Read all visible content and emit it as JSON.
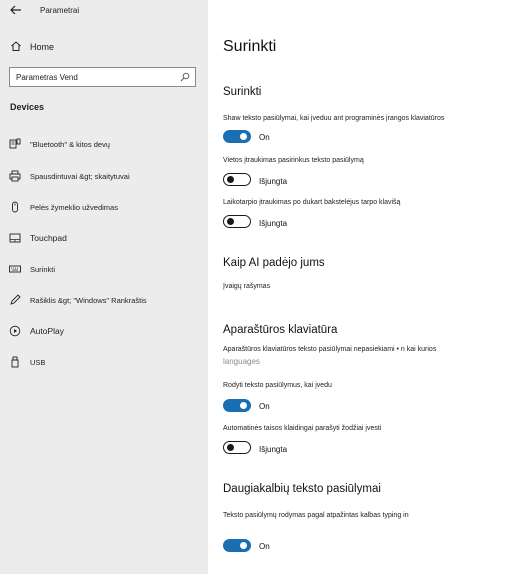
{
  "window": {
    "title": "Parametrai"
  },
  "sidebar": {
    "home": "Home",
    "search": {
      "value": "Parametras Vend",
      "placeholder": "Parametras Vend"
    },
    "section": "Devices",
    "items": [
      {
        "label": "\"Bluetooth\" & kitos devų",
        "icon": "bluetooth-devices-icon"
      },
      {
        "label": "Spausdintuvai &gt; skaitytuvai",
        "icon": "printer-icon"
      },
      {
        "label": "Pelės žymeklio užvedimas",
        "icon": "mouse-icon"
      },
      {
        "label": "Touchpad",
        "icon": "touchpad-icon"
      },
      {
        "label": "Surinkti",
        "icon": "keyboard-icon"
      },
      {
        "label": "Rašiklis &gt; \"Windows\" Rankraštis",
        "icon": "pen-icon"
      },
      {
        "label": "AutoPlay",
        "icon": "autoplay-icon"
      },
      {
        "label": "USB",
        "icon": "usb-icon"
      }
    ]
  },
  "main": {
    "title": "Surinkti",
    "typing": {
      "heading": "Surinkti",
      "settings": [
        {
          "desc": "Shaw teksto pasiūlymai, kai įveduu ant programinės įrangos klaviatūros",
          "state": "On"
        },
        {
          "desc": "Vietos įtraukimas pasirinkus teksto pasiūlymą",
          "state": "Išjungta"
        },
        {
          "desc": "Laikotarpio įtraukimas po dukart bakstelėjus tarpo klavišą",
          "state": "Išjungta"
        }
      ]
    },
    "ai": {
      "heading": "Kaip AI padėjo jums",
      "item": "Įvaigų rašymas"
    },
    "hardware": {
      "heading": "Aparaštūros klaviatūra",
      "desc": "Aparaštūros klaviatūros teksto pasiūlymai nepasiekiami • n kai kurios",
      "muted": "languages",
      "settings": [
        {
          "desc": "Rodyti teksto pasiūlymus, kai įvedu",
          "state": "On"
        },
        {
          "desc": "Automatinės taisos klaidingai parašyti žodžiai įvesti",
          "state": "Išjungta"
        }
      ]
    },
    "multilingual": {
      "heading": "Daugiakalbių teksto pasiūlymai",
      "desc": "Teksto pasiūlymų rodymas pagal atpažintas kalbas typing in",
      "state": "On"
    }
  },
  "colors": {
    "accent": "#1a6fb3",
    "sidebar_bg": "#ececec"
  }
}
